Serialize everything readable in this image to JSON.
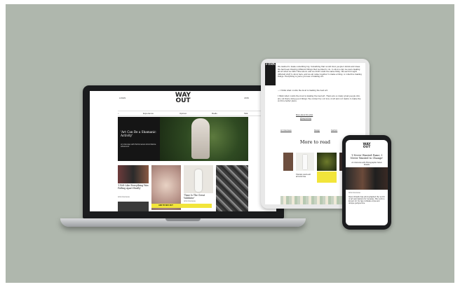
{
  "laptop": {
    "top_left": "LOGIN",
    "logo_line1": "WAY",
    "logo_line2": "OUT",
    "top_right": "JOIN",
    "nav": [
      "Experience",
      "Opinion",
      "Radio",
      "Talk"
    ],
    "hero_title": "'Art Can Be a Shamanic Activity'",
    "hero_sub": "An Interview with Performance Artist Marina Abramović",
    "card1_title": "'I Felt Like Everything Was Falling Apart Really'",
    "card1_meta": "Artist Interviews",
    "card2_button": "ADD TO WAY OUT",
    "card3_title": "'Time Is The Great Validator'",
    "card3_meta": "Artist Interviews"
  },
  "tablet": {
    "strip": "FVRK",
    "para1": "We wanted to make something big. Something that would blow people's minds and ideas. We had been drawing different things that we liked to do, to show a day we were making about what we didn't like about, and we didn't want the same thing. We each brought different stuff to show here, and we all came together to make a thing. A collective making things. Everything is just a process of making art.",
    "para2": "— I think what counts the most is making the best art.",
    "para3": "I think what counts the most is making the best art. There are so many great people who are out there doing good things. We connect by our love of art and our desire to make the world a better place.",
    "link1": "More about this artist",
    "link2": "@wayoutmag",
    "tags": [
      "Art Interviews",
      "Design",
      "Fashion"
    ],
    "more": "More to read",
    "card_caption": "Visions were all around me"
  },
  "phone": {
    "title": "'I Never Wanted Fame, I Never Wanted to Change'",
    "sub": "An Interview with Photographer Steve Shields",
    "meta": "Artist Interviews",
    "body": "Steve Shields has photographed the world of art and fashion for decades. His work is known for its raw, intimate style and unique perspective."
  },
  "colors": {
    "background": "#afb7ad",
    "accent_yellow": "#f2e53a"
  }
}
